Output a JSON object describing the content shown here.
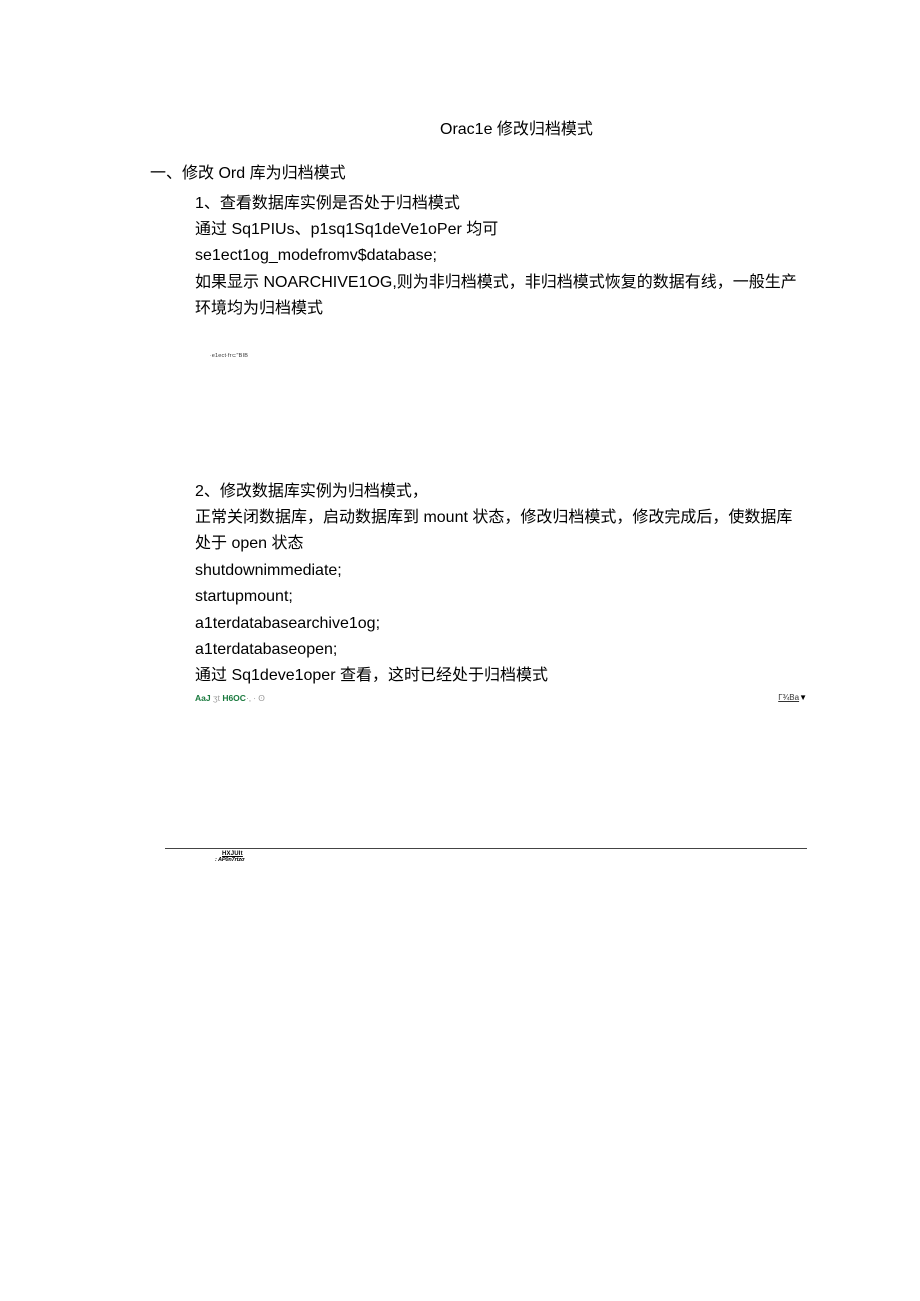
{
  "title": "Orac1e 修改归档模式",
  "section1": {
    "heading": "一、修改 Ord 库为归档模式",
    "item1": {
      "num": "1、查看数据库实例是否处于归档模式",
      "l1": "通过 Sq1PIUs、p1sq1Sq1deVe1oPer 均可",
      "l2": "se1ect1og_modefromv$database;",
      "l3": "如果显示 NOARCHIVE1OG,则为非归档模式，非归档模式恢复的数据有线，一般生产环境均为归档模式"
    },
    "artifact1": {
      "text": "∙e1ect∙fr⊂\"BIB"
    },
    "item2": {
      "num": "2、修改数据库实例为归档模式，",
      "l1": "正常关闭数据库，启动数据库到 mount 状态，修改归档模式，修改完成后，使数据库处于 open 状态",
      "l2": "shutdownimmediate;",
      "l3": "startupmount;",
      "l4": "a1terdatabasearchive1og;",
      "l5": "a1terdatabaseopen;",
      "l6": "通过 Sq1deve1oper 查看，这时已经处于归档模式"
    },
    "toolbar": {
      "left_green": "AaJ",
      "left_gray1": " ʒt ",
      "left_green2": "H6OC",
      "left_gray2": "·, ∙ ʘ",
      "right": "Γ¾Ba",
      "triangle": "▼"
    },
    "footer": {
      "l1": "HXJUIt",
      "l2": ":  AP0n7rtzσ"
    }
  }
}
